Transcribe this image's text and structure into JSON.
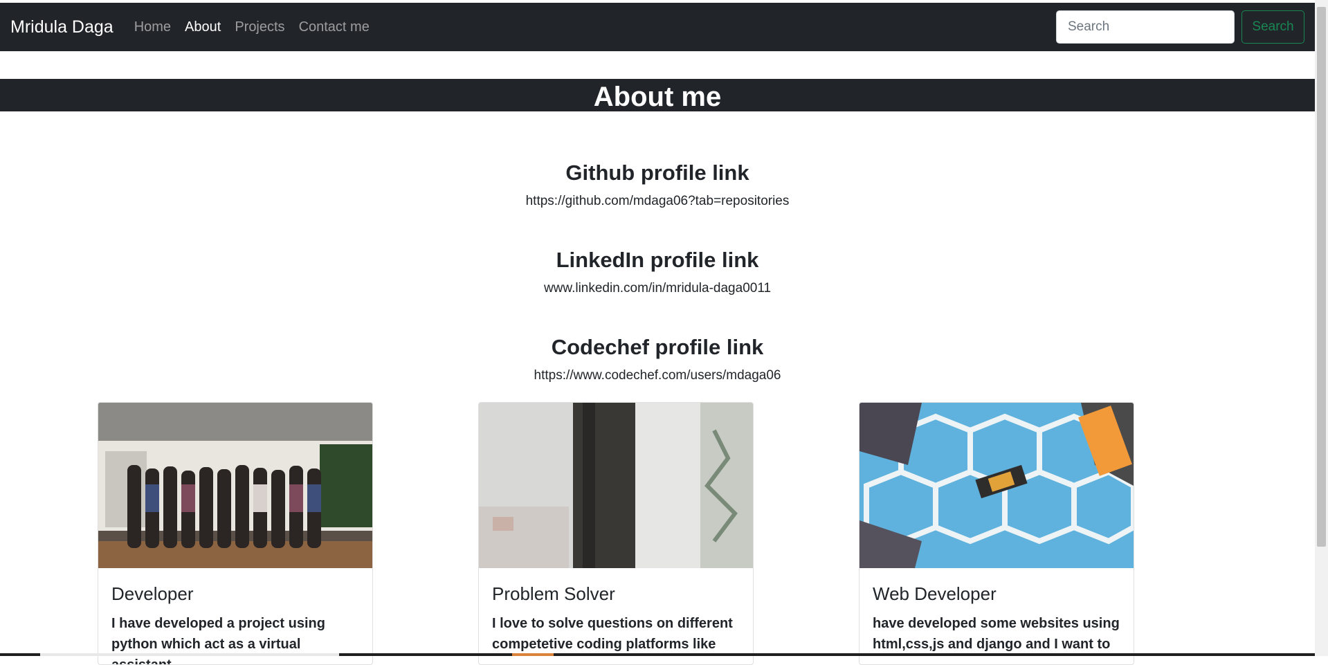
{
  "navbar": {
    "brand": "Mridula Daga",
    "links": [
      "Home",
      "About",
      "Projects",
      "Contact me"
    ],
    "active_link": "About",
    "search_placeholder": "Search",
    "search_button": "Search"
  },
  "banner": {
    "title": "About me"
  },
  "profiles": [
    {
      "title": "Github profile link",
      "link": "https://github.com/mdaga06?tab=repositories"
    },
    {
      "title": "LinkedIn profile link",
      "link": "www.linkedin.com/in/mridula-daga0011"
    },
    {
      "title": "Codechef profile link",
      "link": "https://www.codechef.com/users/mdaga06"
    }
  ],
  "cards": [
    {
      "title": "Developer",
      "text": "I have developed a project using python which act as a virtual assistant"
    },
    {
      "title": "Problem Solver",
      "text": "I love to solve questions on different competetive coding platforms like"
    },
    {
      "title": "Web Developer",
      "text": "have developed some websites using html,css,js and django and I want to"
    }
  ],
  "colors": {
    "navbar_bg": "#212529",
    "accent_green": "#198754"
  }
}
